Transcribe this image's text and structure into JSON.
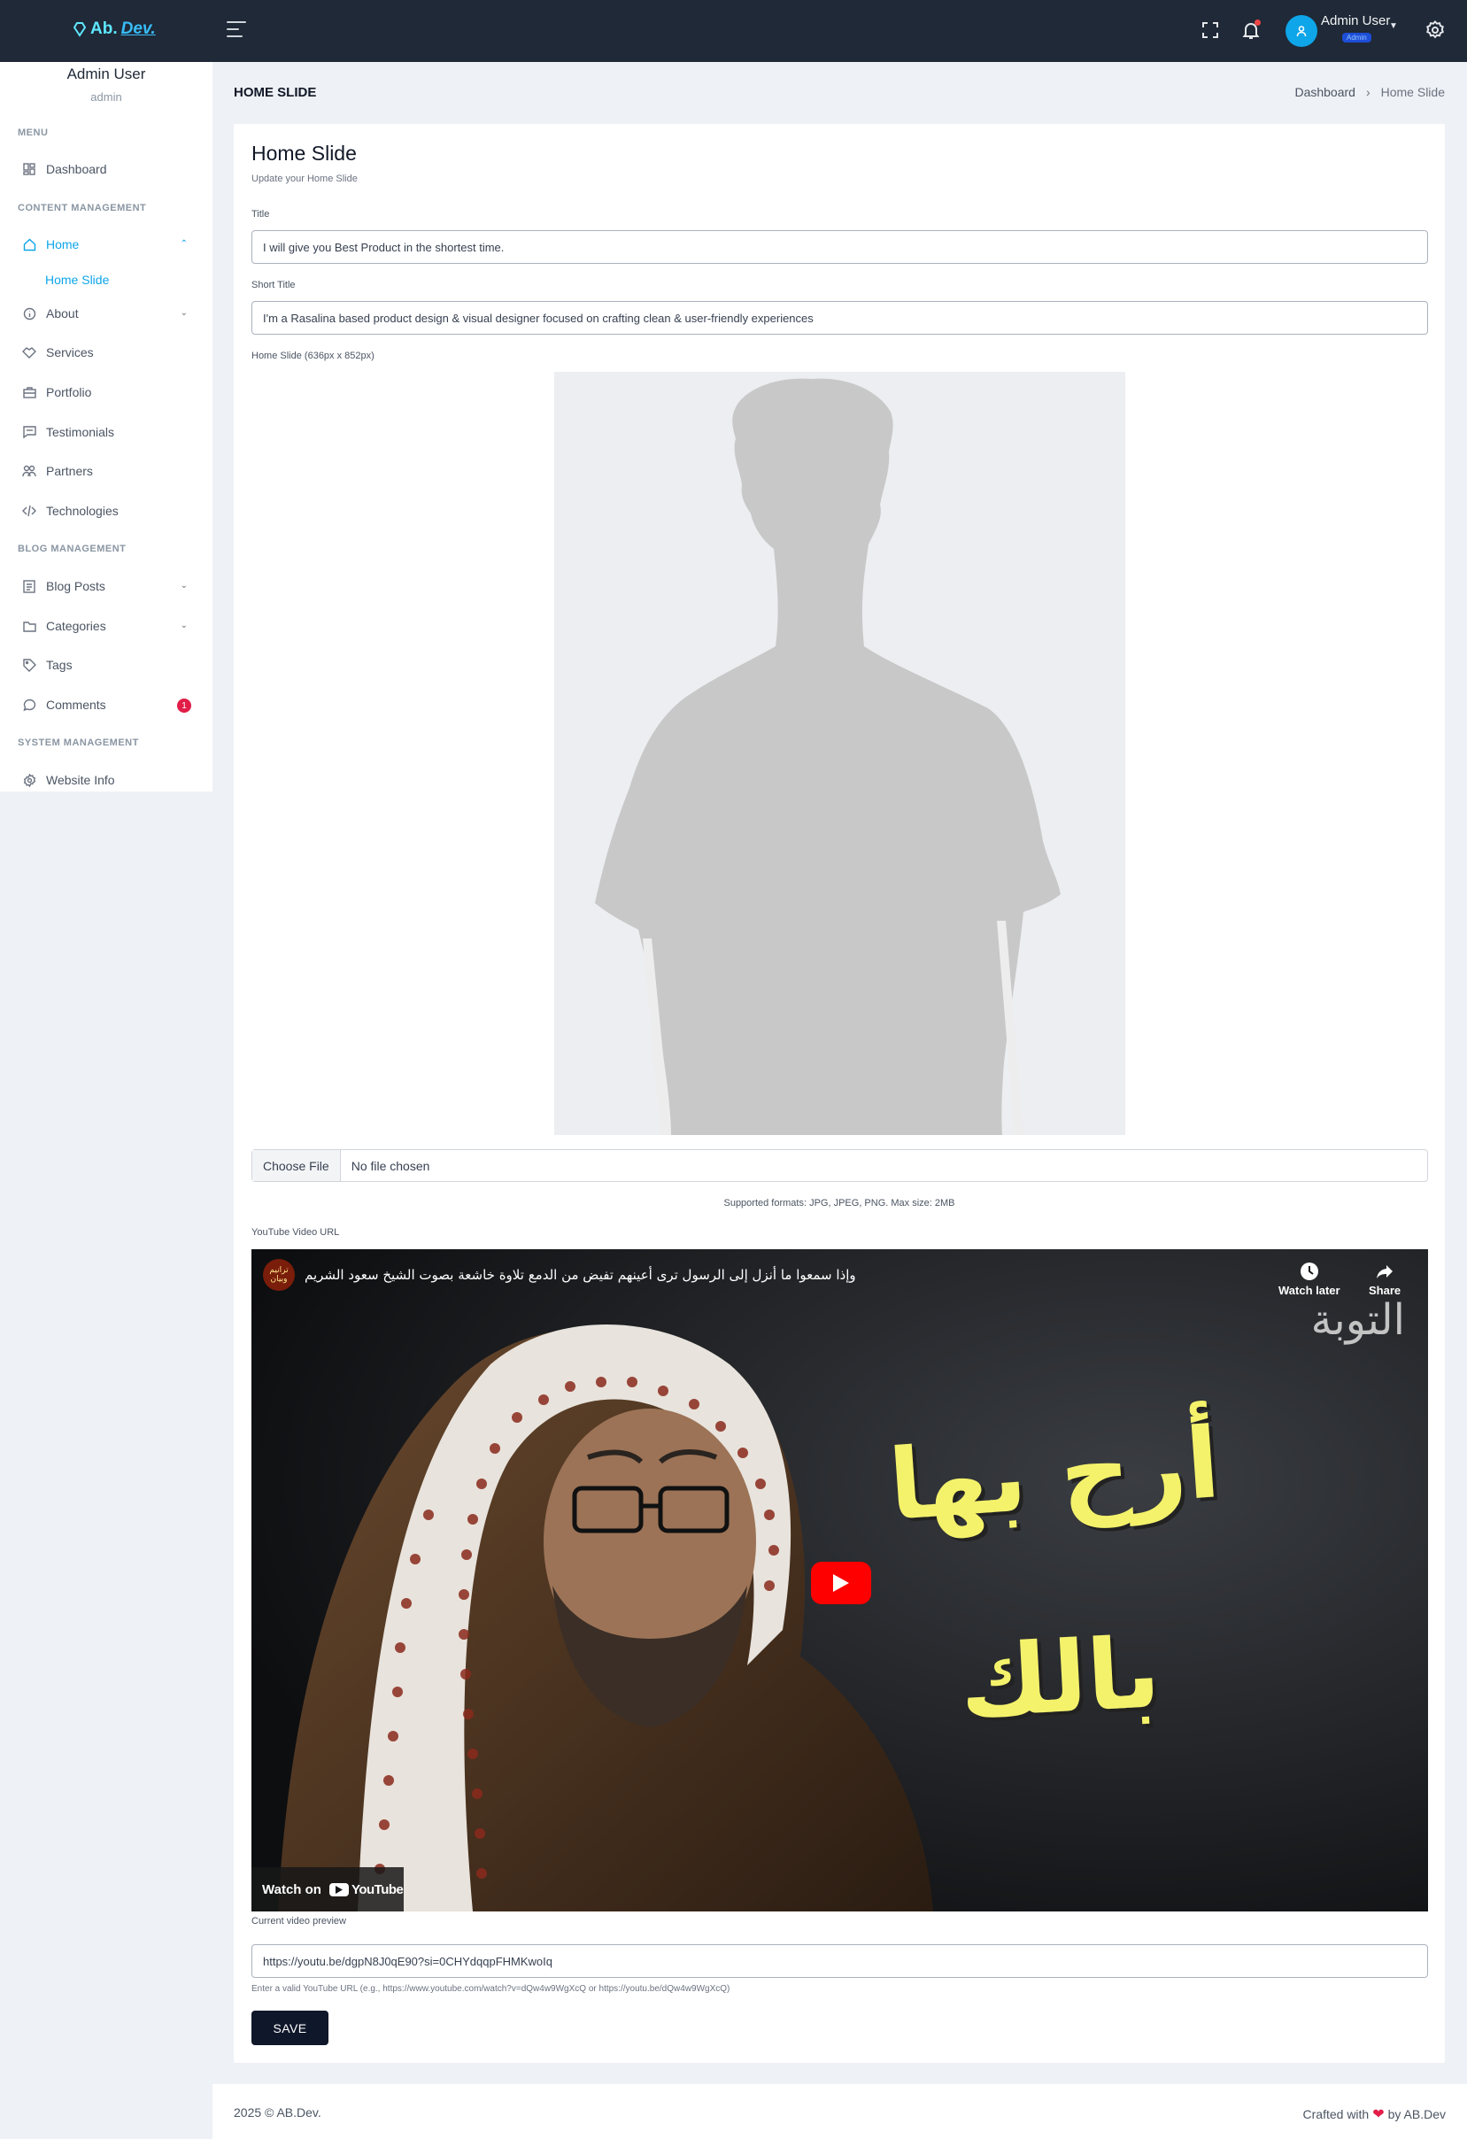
{
  "topbar": {
    "logo_text": "Ab.",
    "logo_text_accent": "Dev.",
    "user_name": "Admin User",
    "user_badge": "Admin"
  },
  "sidebar": {
    "user_name": "Admin User",
    "user_role": "admin",
    "sections": {
      "menu": "MENU",
      "content": "CONTENT MANAGEMENT",
      "blog": "BLOG MANAGEMENT",
      "system": "SYSTEM MANAGEMENT"
    },
    "items": {
      "dashboard": "Dashboard",
      "home": "Home",
      "home_slide": "Home Slide",
      "about": "About",
      "services": "Services",
      "portfolio": "Portfolio",
      "testimonials": "Testimonials",
      "partners": "Partners",
      "technologies": "Technologies",
      "blog_posts": "Blog Posts",
      "categories": "Categories",
      "tags": "Tags",
      "comments": "Comments",
      "website_info": "Website Info"
    },
    "comments_count": "1"
  },
  "page": {
    "title": "HOME SLIDE",
    "breadcrumb": [
      "Dashboard",
      "Home Slide"
    ]
  },
  "form": {
    "heading": "Home Slide",
    "subheading": "Update your Home Slide",
    "title_label": "Title",
    "title_value": "I will give you Best Product in the shortest time.",
    "short_title_label": "Short Title",
    "short_title_value": "I'm a Rasalina based product design & visual designer focused on crafting clean & user-friendly experiences",
    "image_label": "Home Slide (636px x 852px)",
    "choose_file": "Choose File",
    "no_file": "No file chosen",
    "formats": "Supported formats: JPG, JPEG, PNG. Max size: 2MB",
    "youtube_label": "YouTube Video URL",
    "video_caption": "Current video preview",
    "url_value": "https://youtu.be/dgpN8J0qE90?si=0CHYdqqpFHMKwoIq",
    "url_help": "Enter a valid YouTube URL (e.g., https://www.youtube.com/watch?v=dQw4w9WgXcQ or https://youtu.be/dQw4w9WgXcQ)",
    "save": "SAVE"
  },
  "video": {
    "title": "وإذا سمعوا ما أنزل إلى الرسول ترى أعينهم تفيض من الدمع تلاوة خاشعة بصوت الشيخ سعود الشريم",
    "channel_badge": "ترانيم وبيان",
    "watch_later": "Watch later",
    "share": "Share",
    "watch_on": "Watch on",
    "youtube": "YouTube",
    "overlay_line1": "أرح بها",
    "overlay_line2": "بالك",
    "watermark": "التوبة"
  },
  "footer": {
    "left": "2025 © AB.Dev.",
    "crafted": "Crafted with",
    "by": "by AB.Dev"
  },
  "colors": {
    "topbar": "#1f2937",
    "accent": "#0ea5e9",
    "save_button": "#0f172a",
    "badge": "#e11d48"
  }
}
